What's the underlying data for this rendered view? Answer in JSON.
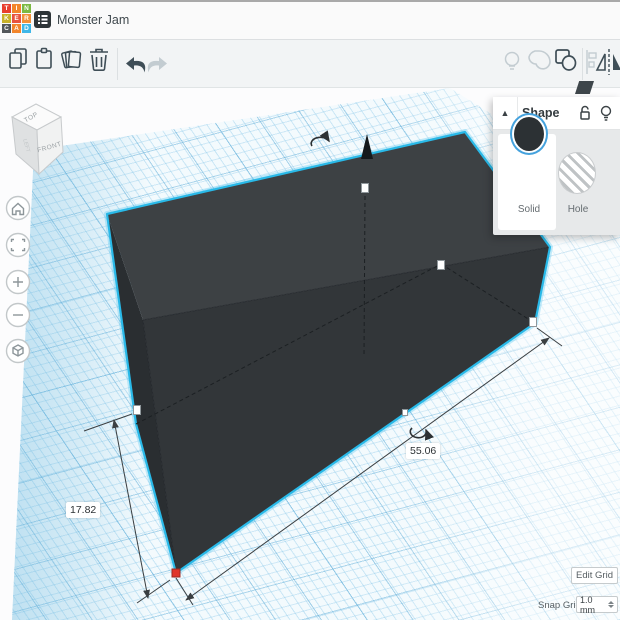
{
  "header": {
    "title": "Monster Jam",
    "logo": [
      {
        "ch": "T",
        "bg": "#e8402f"
      },
      {
        "ch": "I",
        "bg": "#f2852b"
      },
      {
        "ch": "N",
        "bg": "#7cb942"
      },
      {
        "ch": "K",
        "bg": "#c8b22a"
      },
      {
        "ch": "E",
        "bg": "#e8543f"
      },
      {
        "ch": "R",
        "bg": "#f29038"
      },
      {
        "ch": "C",
        "bg": "#53575a"
      },
      {
        "ch": "A",
        "bg": "#f2852b"
      },
      {
        "ch": "D",
        "bg": "#3fb7e8"
      }
    ]
  },
  "viewcube": {
    "top": "TOP",
    "front": "FRONT",
    "left": "LEFT"
  },
  "shape_panel": {
    "title": "Shape",
    "solid_label": "Solid",
    "hole_label": "Hole"
  },
  "dimensions": {
    "length": "55.06",
    "height": "17.82"
  },
  "grid_controls": {
    "edit_grid": "Edit Grid",
    "snap_label": "Snap Grid",
    "snap_value": "1.0 mm"
  },
  "colors": {
    "selection_accent": "#29b9e8",
    "handle_red": "#e0362b",
    "solid_swatch": "#2c3134",
    "swatch_ring": "#45a2dd",
    "box_top": "#3d4144",
    "box_front": "#323639",
    "box_left": "#2a2e31"
  }
}
